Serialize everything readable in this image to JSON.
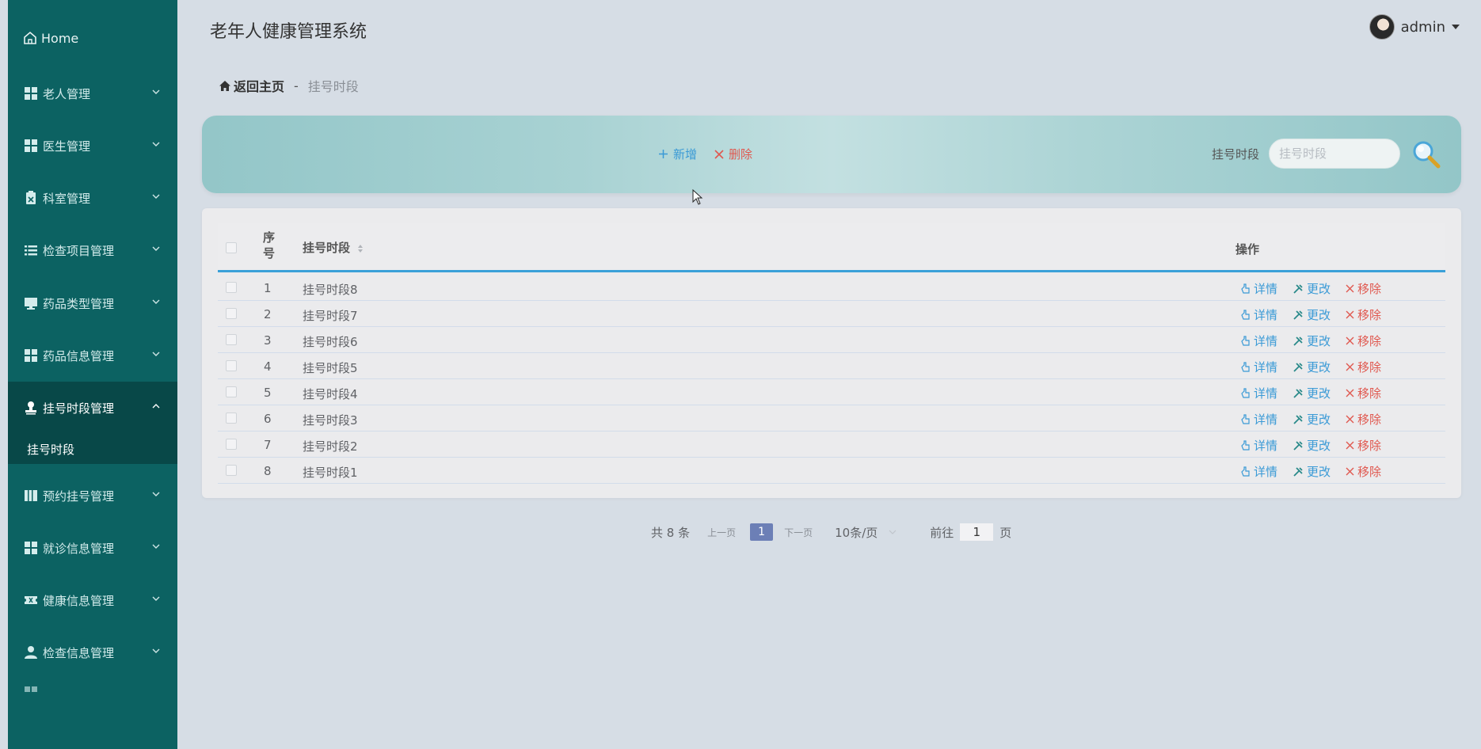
{
  "app": {
    "title": "老年人健康管理系统"
  },
  "user": {
    "name": "admin"
  },
  "sidebar": {
    "home": "Home",
    "items": [
      {
        "label": "老人管理",
        "icon": "grid-icon"
      },
      {
        "label": "医生管理",
        "icon": "grid-icon"
      },
      {
        "label": "科室管理",
        "icon": "clipboard-icon"
      },
      {
        "label": "检查项目管理",
        "icon": "list-icon"
      },
      {
        "label": "药品类型管理",
        "icon": "monitor-icon"
      },
      {
        "label": "药品信息管理",
        "icon": "grid-icon"
      },
      {
        "label": "挂号时段管理",
        "icon": "user-stamp-icon",
        "active": true
      },
      {
        "label": "预约挂号管理",
        "icon": "book-icon"
      },
      {
        "label": "就诊信息管理",
        "icon": "grid-icon"
      },
      {
        "label": "健康信息管理",
        "icon": "ticket-icon"
      },
      {
        "label": "检查信息管理",
        "icon": "user-icon"
      }
    ],
    "active_sub": "挂号时段"
  },
  "breadcrumb": {
    "home": "返回主页",
    "separator": "-",
    "current": "挂号时段"
  },
  "toolbar": {
    "add_label": "新增",
    "delete_label": "删除",
    "search_label": "挂号时段",
    "search_placeholder": "挂号时段"
  },
  "table": {
    "headers": {
      "index": "序号",
      "name": "挂号时段",
      "actions": "操作"
    },
    "rows": [
      {
        "index": "1",
        "name": "挂号时段8"
      },
      {
        "index": "2",
        "name": "挂号时段7"
      },
      {
        "index": "3",
        "name": "挂号时段6"
      },
      {
        "index": "4",
        "name": "挂号时段5"
      },
      {
        "index": "5",
        "name": "挂号时段4"
      },
      {
        "index": "6",
        "name": "挂号时段3"
      },
      {
        "index": "7",
        "name": "挂号时段2"
      },
      {
        "index": "8",
        "name": "挂号时段1"
      }
    ],
    "row_actions": {
      "detail": "详情",
      "edit": "更改",
      "remove": "移除"
    }
  },
  "pagination": {
    "total": "共 8 条",
    "prev": "上一页",
    "current_page": "1",
    "next": "下一页",
    "page_size": "10条/页",
    "goto_prefix": "前往",
    "goto_value": "1",
    "goto_suffix": "页"
  },
  "colors": {
    "sidebar": "#0c6262",
    "accent_blue": "#3a9ad6",
    "danger": "#e0584f",
    "page_active": "#6c7fb6"
  }
}
